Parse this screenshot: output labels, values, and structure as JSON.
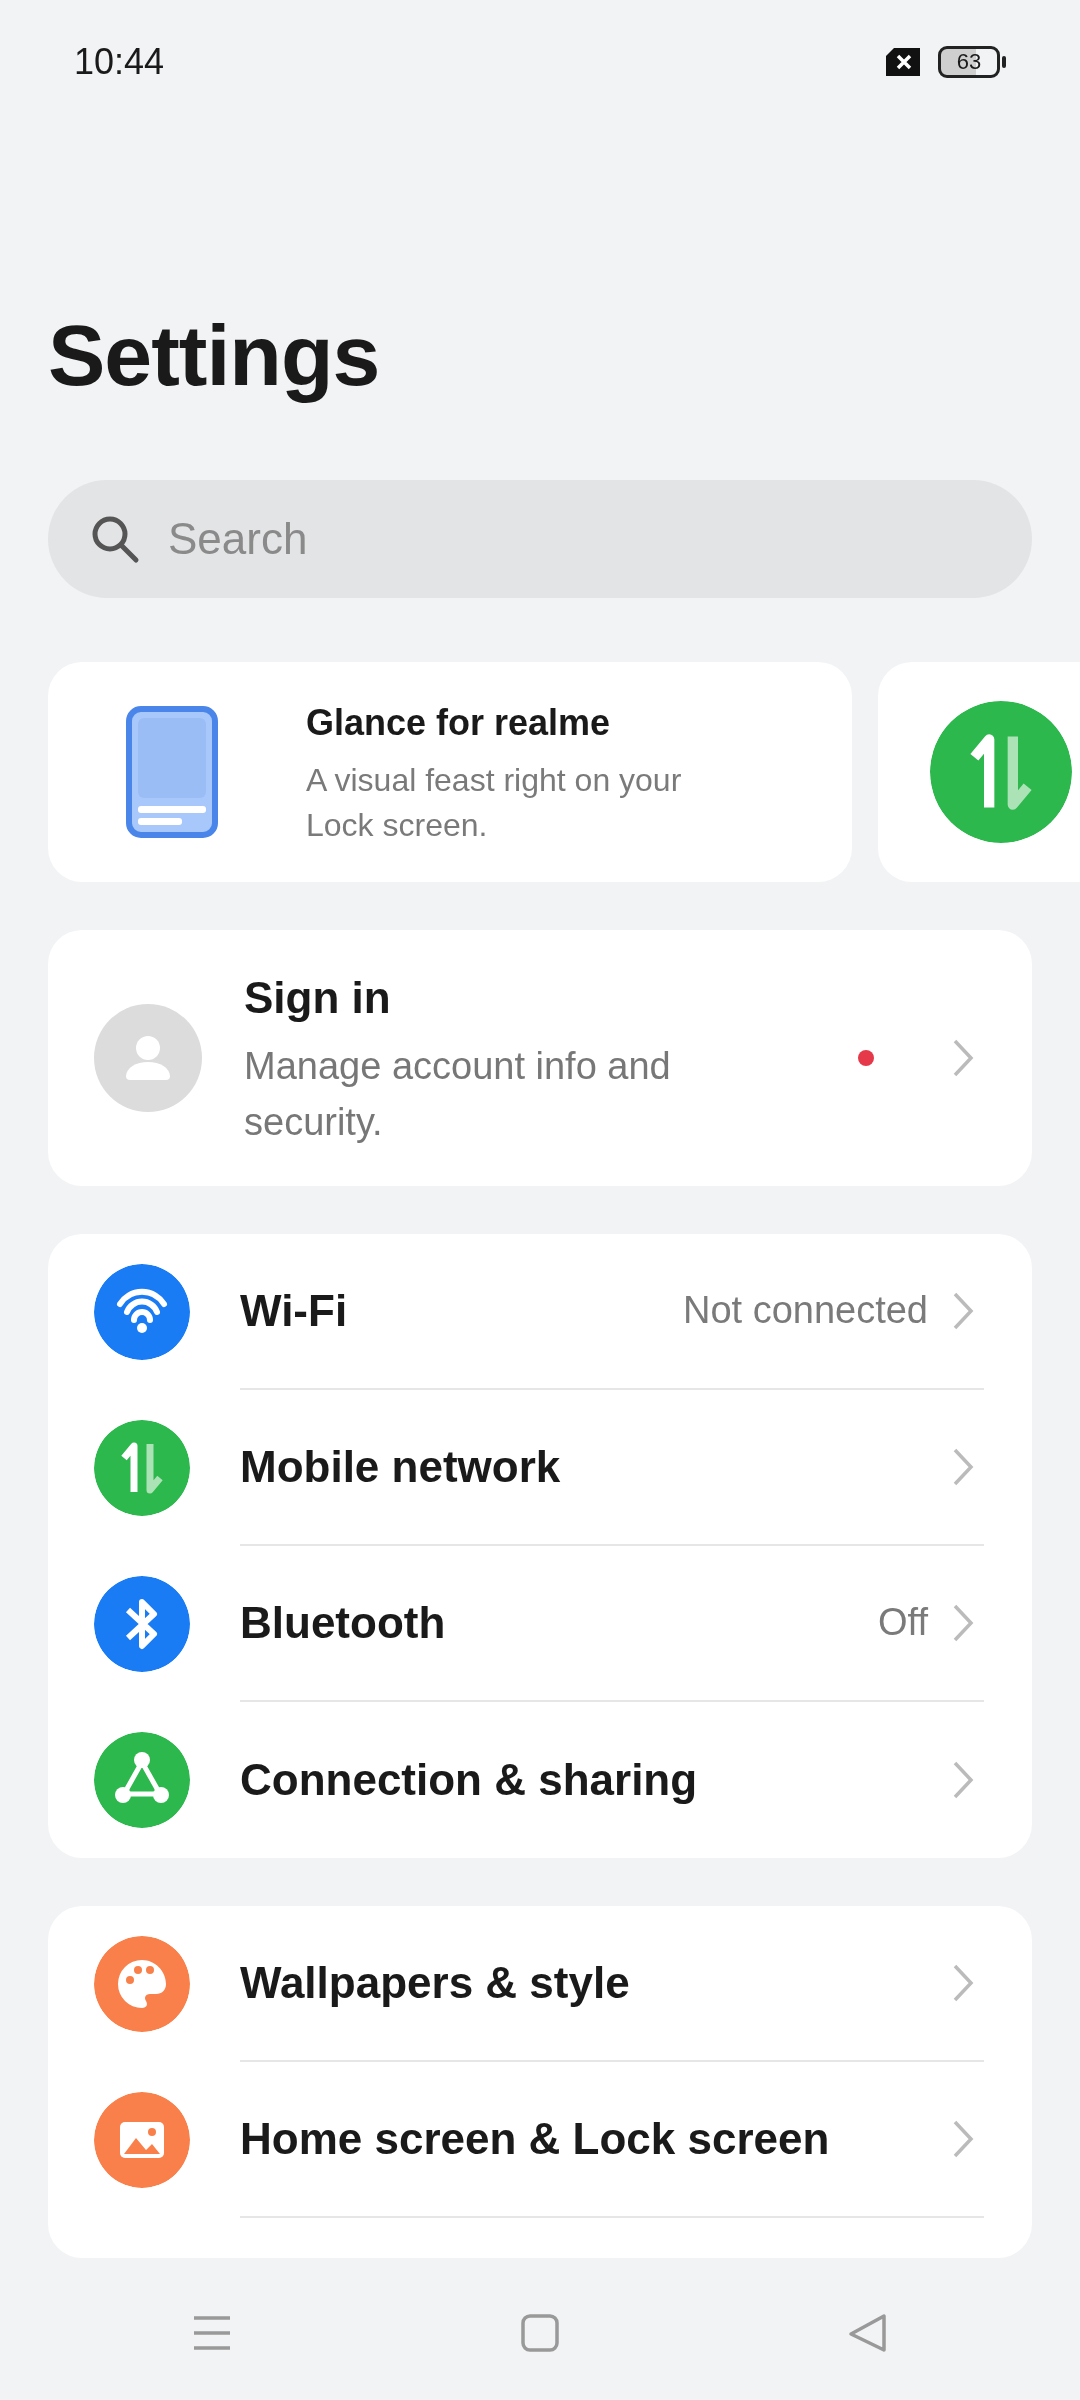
{
  "status_bar": {
    "time": "10:44",
    "battery": "63"
  },
  "title": "Settings",
  "search": {
    "placeholder": "Search"
  },
  "carousel": [
    {
      "kind": "glance",
      "title": "Glance for realme",
      "subtitle": "A visual feast right on your Lock screen."
    },
    {
      "kind": "mobile"
    }
  ],
  "account": {
    "title": "Sign in",
    "subtitle": "Manage account info and security.",
    "notification_dot": true
  },
  "groups": [
    {
      "items": [
        {
          "kind": "wifi",
          "color": "#1a7cf5",
          "label": "Wi-Fi",
          "value": "Not connected"
        },
        {
          "kind": "mobile",
          "color": "#2db84d",
          "label": "Mobile network"
        },
        {
          "kind": "bluetooth",
          "color": "#1a7cf5",
          "label": "Bluetooth",
          "value": "Off"
        },
        {
          "kind": "share",
          "color": "#2db84d",
          "label": "Connection & sharing"
        }
      ]
    },
    {
      "items": [
        {
          "kind": "palette",
          "color": "#f9804a",
          "label": "Wallpapers & style"
        },
        {
          "kind": "image",
          "color": "#f9804a",
          "label": "Home screen & Lock screen"
        }
      ]
    }
  ]
}
